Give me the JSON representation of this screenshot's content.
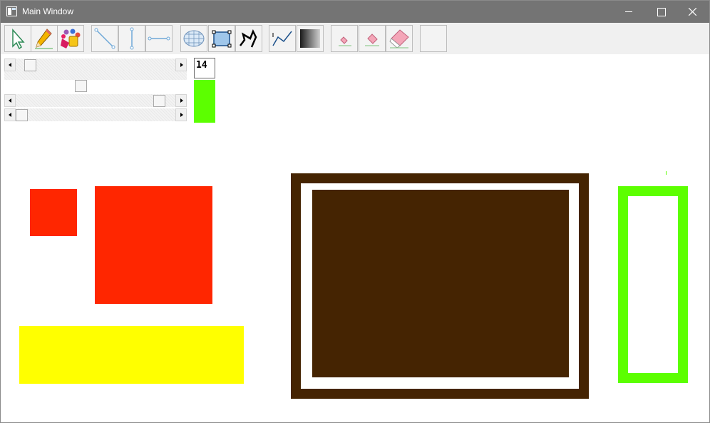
{
  "window": {
    "title": "Main Window",
    "app_icon": "window-app-icon",
    "controls": [
      "minimize-icon",
      "maximize-icon",
      "close-icon"
    ]
  },
  "toolbar": {
    "tools": [
      {
        "name": "select-arrow",
        "icon": "cursor-arrow-icon"
      },
      {
        "name": "pencil",
        "icon": "pencil-icon"
      },
      {
        "name": "paint-palette",
        "icon": "paint-palette-icon"
      },
      {
        "name": "diagonal-line",
        "icon": "diagonal-line-icon"
      },
      {
        "name": "vertical-line",
        "icon": "vertical-line-icon"
      },
      {
        "name": "horizontal-line",
        "icon": "horizontal-line-icon"
      },
      {
        "name": "mesh-fill",
        "icon": "mesh-sphere-icon"
      },
      {
        "name": "rectangle-select",
        "icon": "rectangle-select-icon"
      },
      {
        "name": "polyline",
        "icon": "polyline-icon"
      },
      {
        "name": "curve",
        "icon": "curve-icon"
      },
      {
        "name": "gradient",
        "icon": "gradient-icon"
      },
      {
        "name": "eraser-small",
        "icon": "eraser-small-icon"
      },
      {
        "name": "eraser-medium",
        "icon": "eraser-medium-icon"
      },
      {
        "name": "eraser-large",
        "icon": "eraser-large-icon"
      },
      {
        "name": "blank",
        "icon": "blank-icon"
      }
    ]
  },
  "controls": {
    "brush_size": "14",
    "current_color": "#5cff00",
    "sliders": [
      {
        "name": "slider-1",
        "value": 0.06
      },
      {
        "name": "slider-2",
        "value": 0.4
      },
      {
        "name": "slider-3",
        "value": 0.93
      },
      {
        "name": "slider-4",
        "value": 0.0
      }
    ]
  },
  "canvas": {
    "background": "#ffffff",
    "shapes": [
      {
        "name": "small-red-square",
        "fill": "#ff2600"
      },
      {
        "name": "large-red-square",
        "fill": "#ff2600"
      },
      {
        "name": "yellow-rectangle",
        "fill": "#ffff00"
      },
      {
        "name": "brown-framed-rectangle",
        "fill": "#452402"
      },
      {
        "name": "green-outlined-rectangle",
        "fill": "#5cff00"
      }
    ]
  }
}
